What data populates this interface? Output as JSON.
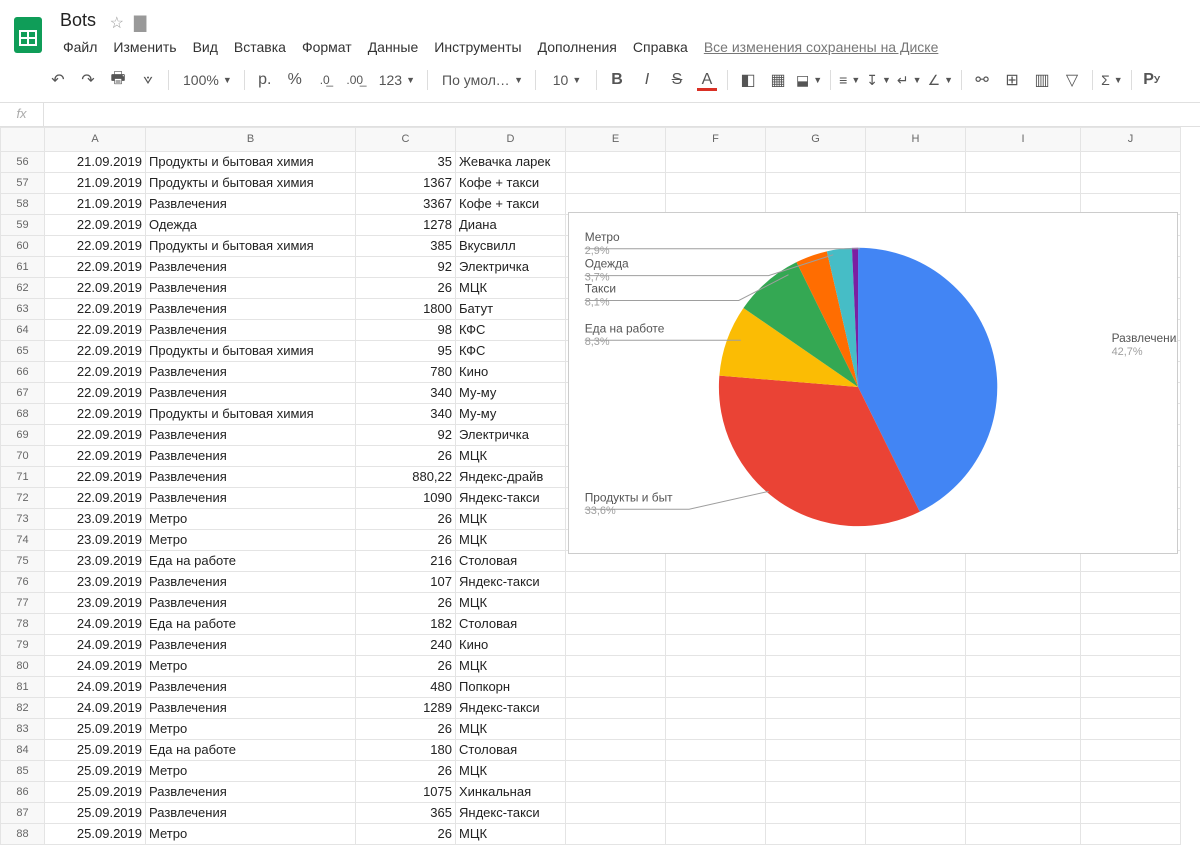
{
  "doc": {
    "title": "Bots"
  },
  "menus": {
    "file": "Файл",
    "edit": "Изменить",
    "view": "Вид",
    "insert": "Вставка",
    "format": "Формат",
    "data": "Данные",
    "tools": "Инструменты",
    "addons": "Дополнения",
    "help": "Справка",
    "save_status": "Все изменения сохранены на Диске"
  },
  "toolbar": {
    "zoom": "100%",
    "currency": "р.",
    "percent": "%",
    "dec_less": ".0",
    "dec_more": ".00",
    "num_fmt": "123",
    "font": "По умолч...",
    "font_size": "10"
  },
  "columns": [
    "A",
    "B",
    "C",
    "D",
    "E",
    "F",
    "G",
    "H",
    "I",
    "J"
  ],
  "rows": [
    {
      "n": 56,
      "a": "21.09.2019",
      "b": "Продукты и бытовая химия",
      "c": "35",
      "d": "Жевачка ларек"
    },
    {
      "n": 57,
      "a": "21.09.2019",
      "b": "Продукты и бытовая химия",
      "c": "1367",
      "d": "Кофе + такси"
    },
    {
      "n": 58,
      "a": "21.09.2019",
      "b": "Развлечения",
      "c": "3367",
      "d": "Кофе + такси"
    },
    {
      "n": 59,
      "a": "22.09.2019",
      "b": "Одежда",
      "c": "1278",
      "d": "Диана"
    },
    {
      "n": 60,
      "a": "22.09.2019",
      "b": "Продукты и бытовая химия",
      "c": "385",
      "d": "Вкусвилл"
    },
    {
      "n": 61,
      "a": "22.09.2019",
      "b": "Развлечения",
      "c": "92",
      "d": "Электричка"
    },
    {
      "n": 62,
      "a": "22.09.2019",
      "b": "Развлечения",
      "c": "26",
      "d": "МЦК"
    },
    {
      "n": 63,
      "a": "22.09.2019",
      "b": "Развлечения",
      "c": "1800",
      "d": "Батут"
    },
    {
      "n": 64,
      "a": "22.09.2019",
      "b": "Развлечения",
      "c": "98",
      "d": "КФС"
    },
    {
      "n": 65,
      "a": "22.09.2019",
      "b": "Продукты и бытовая химия",
      "c": "95",
      "d": "КФС"
    },
    {
      "n": 66,
      "a": "22.09.2019",
      "b": "Развлечения",
      "c": "780",
      "d": "Кино"
    },
    {
      "n": 67,
      "a": "22.09.2019",
      "b": "Развлечения",
      "c": "340",
      "d": "Му-му"
    },
    {
      "n": 68,
      "a": "22.09.2019",
      "b": "Продукты и бытовая химия",
      "c": "340",
      "d": "Му-му"
    },
    {
      "n": 69,
      "a": "22.09.2019",
      "b": "Развлечения",
      "c": "92",
      "d": "Электричка"
    },
    {
      "n": 70,
      "a": "22.09.2019",
      "b": "Развлечения",
      "c": "26",
      "d": "МЦК"
    },
    {
      "n": 71,
      "a": "22.09.2019",
      "b": "Развлечения",
      "c": "880,22",
      "d": "Яндекс-драйв"
    },
    {
      "n": 72,
      "a": "22.09.2019",
      "b": "Развлечения",
      "c": "1090",
      "d": "Яндекс-такси"
    },
    {
      "n": 73,
      "a": "23.09.2019",
      "b": "Метро",
      "c": "26",
      "d": "МЦК"
    },
    {
      "n": 74,
      "a": "23.09.2019",
      "b": "Метро",
      "c": "26",
      "d": "МЦК"
    },
    {
      "n": 75,
      "a": "23.09.2019",
      "b": "Еда на работе",
      "c": "216",
      "d": "Столовая"
    },
    {
      "n": 76,
      "a": "23.09.2019",
      "b": "Развлечения",
      "c": "107",
      "d": "Яндекс-такси"
    },
    {
      "n": 77,
      "a": "23.09.2019",
      "b": "Развлечения",
      "c": "26",
      "d": "МЦК"
    },
    {
      "n": 78,
      "a": "24.09.2019",
      "b": "Еда на работе",
      "c": "182",
      "d": "Столовая"
    },
    {
      "n": 79,
      "a": "24.09.2019",
      "b": "Развлечения",
      "c": "240",
      "d": "Кино"
    },
    {
      "n": 80,
      "a": "24.09.2019",
      "b": "Метро",
      "c": "26",
      "d": "МЦК"
    },
    {
      "n": 81,
      "a": "24.09.2019",
      "b": "Развлечения",
      "c": "480",
      "d": "Попкорн"
    },
    {
      "n": 82,
      "a": "24.09.2019",
      "b": "Развлечения",
      "c": "1289",
      "d": "Яндекс-такси"
    },
    {
      "n": 83,
      "a": "25.09.2019",
      "b": "Метро",
      "c": "26",
      "d": "МЦК"
    },
    {
      "n": 84,
      "a": "25.09.2019",
      "b": "Еда на работе",
      "c": "180",
      "d": "Столовая"
    },
    {
      "n": 85,
      "a": "25.09.2019",
      "b": "Метро",
      "c": "26",
      "d": "МЦК"
    },
    {
      "n": 86,
      "a": "25.09.2019",
      "b": "Развлечения",
      "c": "1075",
      "d": "Хинкальная"
    },
    {
      "n": 87,
      "a": "25.09.2019",
      "b": "Развлечения",
      "c": "365",
      "d": "Яндекс-такси"
    },
    {
      "n": 88,
      "a": "25.09.2019",
      "b": "Метро",
      "c": "26",
      "d": "МЦК"
    }
  ],
  "chart_data": {
    "type": "pie",
    "series": [
      {
        "name": "Развлечения",
        "pct": 42.7,
        "color": "#4285f4",
        "label_pct": "42,7%"
      },
      {
        "name": "Продукты и быт",
        "pct": 33.6,
        "color": "#ea4335",
        "label_pct": "33,6%"
      },
      {
        "name": "Еда на работе",
        "pct": 8.3,
        "color": "#fbbc04",
        "label_pct": "8,3%"
      },
      {
        "name": "Такси",
        "pct": 8.1,
        "color": "#34a853",
        "label_pct": "8,1%"
      },
      {
        "name": "Одежда",
        "pct": 3.7,
        "color": "#ff6d01",
        "label_pct": "3,7%"
      },
      {
        "name": "Метро",
        "pct": 2.9,
        "color": "#46bdc6",
        "label_pct": "2,9%"
      },
      {
        "name": "",
        "pct": 0.7,
        "color": "#7b1fa2",
        "label_pct": ""
      }
    ]
  }
}
